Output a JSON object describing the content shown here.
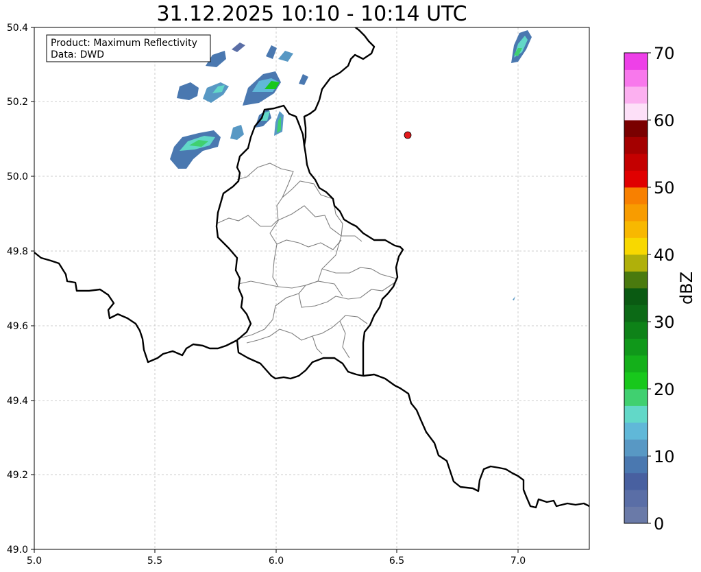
{
  "title": "31.12.2025 10:10 - 10:14 UTC",
  "info_box": {
    "product_line": "Product: Maximum Reflectivity",
    "data_line": "Data: DWD"
  },
  "map": {
    "lon_range": [
      5.0,
      7.3
    ],
    "lat_range": [
      49.0,
      50.4
    ],
    "x_ticks": [
      "5.0",
      "5.5",
      "6.0",
      "6.5",
      "7.0"
    ],
    "y_ticks": [
      "49.0",
      "49.2",
      "49.4",
      "49.6",
      "49.8",
      "50.0",
      "50.2",
      "50.4"
    ],
    "grid": true,
    "marker": {
      "lon": 6.55,
      "lat": 50.11,
      "color": "#e31a1c"
    }
  },
  "colorbar": {
    "unit": "dBZ",
    "range": [
      0,
      70
    ],
    "tick_labels": [
      "0",
      "10",
      "20",
      "30",
      "40",
      "50",
      "60",
      "70"
    ],
    "colors": [
      "#6a7aa8",
      "#5a6ea6",
      "#4860a0",
      "#4a78b0",
      "#5898c4",
      "#60b8d8",
      "#62d8c8",
      "#40d070",
      "#18c81c",
      "#14b01a",
      "#10981a",
      "#0e8218",
      "#0c6a16",
      "#0a5a12",
      "#4a7a0e",
      "#b0b00a",
      "#f8d800",
      "#f8b800",
      "#f89c00",
      "#f88000",
      "#e00000",
      "#c40000",
      "#a40000",
      "#7a0000",
      "#fde0f8",
      "#fcb0f0",
      "#f878ec",
      "#ee40e8"
    ]
  }
}
